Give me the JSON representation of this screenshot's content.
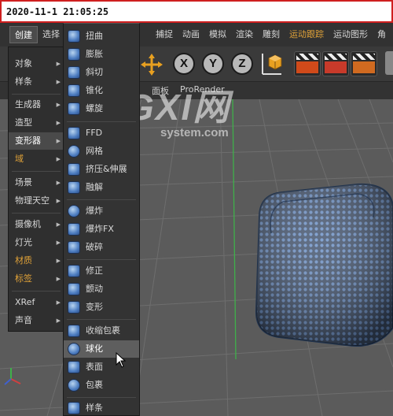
{
  "timestamp": "2020-11-1 21:05:25",
  "menubar": {
    "items": [
      "创建",
      "选择",
      "捕捉",
      "动画",
      "模拟",
      "渲染",
      "雕刻",
      "运动跟踪",
      "运动图形",
      "角"
    ]
  },
  "toolbar": {
    "axis_x": "X",
    "axis_y": "Y",
    "axis_z": "Z"
  },
  "subbar": {
    "panel": "面板",
    "prorender": "ProRender"
  },
  "create_menu": {
    "items": [
      {
        "label": "对象",
        "submenu": true
      },
      {
        "label": "样条",
        "submenu": true
      },
      {
        "label": "生成器",
        "submenu": true
      },
      {
        "label": "造型",
        "submenu": true
      },
      {
        "label": "变形器",
        "submenu": true
      },
      {
        "label": "域",
        "submenu": true
      },
      {
        "label": "场景",
        "submenu": true
      },
      {
        "label": "物理天空",
        "submenu": true
      },
      {
        "label": "摄像机",
        "submenu": true
      },
      {
        "label": "灯光",
        "submenu": true
      },
      {
        "label": "材质",
        "submenu": true
      },
      {
        "label": "标签",
        "submenu": true
      },
      {
        "label": "XRef",
        "submenu": true
      },
      {
        "label": "声音",
        "submenu": true
      }
    ]
  },
  "deformer_menu": {
    "items": [
      "扭曲",
      "膨胀",
      "斜切",
      "锥化",
      "螺旋",
      "FFD",
      "网格",
      "挤压&伸展",
      "融解",
      "爆炸",
      "爆炸FX",
      "破碎",
      "修正",
      "颤动",
      "变形",
      "收缩包裹",
      "球化",
      "表面",
      "包裹",
      "样条"
    ],
    "selected": "球化"
  },
  "watermark": {
    "logo": "GXI网",
    "site": "system.com"
  },
  "colors": {
    "accent_orange": "#e0a238",
    "timestamp_border": "#cf1f1f",
    "mesh_blue": "#5b80b8"
  },
  "icons": [
    "cursor-arrow-icon",
    "move-tool-icon",
    "cube-icon",
    "render-clapper-icon",
    "render-settings-icon",
    "deformer-icon"
  ]
}
